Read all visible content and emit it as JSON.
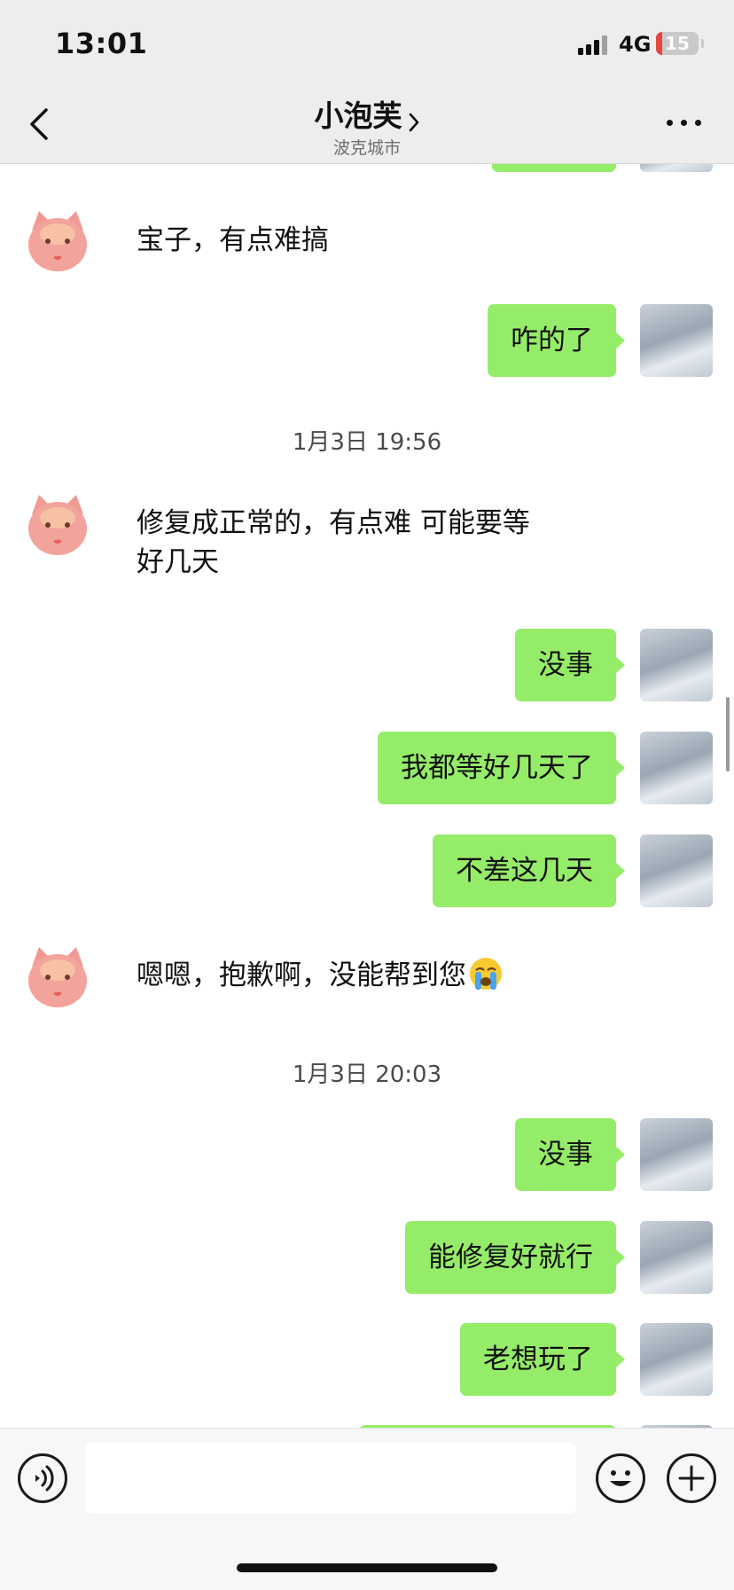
{
  "status_bar": {
    "time": "13:01",
    "network": "4G",
    "battery": "15"
  },
  "nav": {
    "title": "小泡芙",
    "subtitle": "波克城市"
  },
  "messages": [
    {
      "side": "other",
      "text": "宝子，有点难搞"
    },
    {
      "side": "me",
      "text": "咋的了"
    },
    {
      "side": "time",
      "text": "1月3日 19:56"
    },
    {
      "side": "other",
      "text_line1": "修复成正常的，有点难 可能要等",
      "text_line2": "好几天"
    },
    {
      "side": "me",
      "text": "没事"
    },
    {
      "side": "me",
      "text": "我都等好几天了"
    },
    {
      "side": "me",
      "text": "不差这几天"
    },
    {
      "side": "other",
      "text": "嗯嗯，抱歉啊，没能帮到您",
      "emoji": "loudly-crying-face"
    },
    {
      "side": "time",
      "text": "1月3日 20:03"
    },
    {
      "side": "me",
      "text": "没事"
    },
    {
      "side": "me",
      "text": "能修复好就行"
    },
    {
      "side": "me",
      "text": "老想玩了"
    }
  ],
  "input_bar": {
    "placeholder": "",
    "value": ""
  },
  "colors": {
    "bubble_me": "#95ec69",
    "bar_bg": "#ededed",
    "battery_low": "#e5463f"
  },
  "icons": [
    "back-chevron-icon",
    "more-dots-icon",
    "voice-icon",
    "emoji-icon",
    "plus-icon"
  ]
}
